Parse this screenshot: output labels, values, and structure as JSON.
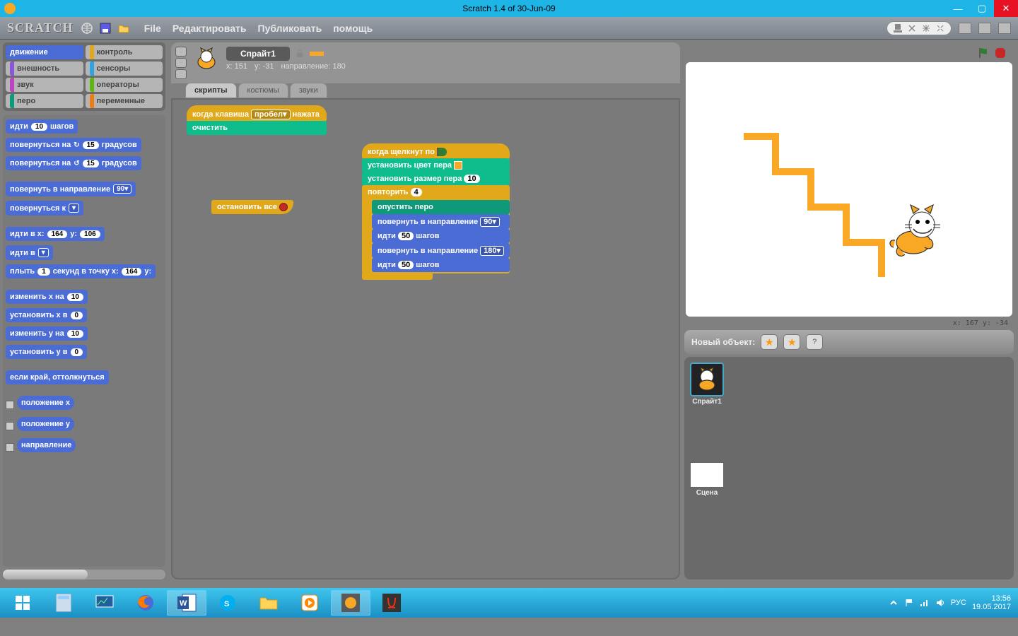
{
  "window": {
    "title": "Scratch 1.4 of 30-Jun-09"
  },
  "menu": {
    "logo": "SCRATCH",
    "items": {
      "file": "File",
      "edit": "Редактировать",
      "share": "Публиковать",
      "help": "помощь"
    }
  },
  "categories": {
    "motion": "движение",
    "control": "контроль",
    "looks": "внешность",
    "sensing": "сенсоры",
    "sound": "звук",
    "operators": "операторы",
    "pen": "перо",
    "variables": "переменные"
  },
  "palette": {
    "go_steps_pre": "идти",
    "go_steps_val": "10",
    "go_steps_post": "шагов",
    "turn_r_pre": "повернуться на",
    "turn_r_val": "15",
    "turn_r_post": "градусов",
    "turn_l_pre": "повернуться на",
    "turn_l_val": "15",
    "turn_l_post": "градусов",
    "point_dir_pre": "повернуть в направление",
    "point_dir_val": "90▾",
    "point_to_pre": "повернуться к",
    "point_to_val": "  ▾",
    "goto_xy_pre": "идти в x:",
    "goto_xy_x": "164",
    "goto_xy_mid": "y:",
    "goto_xy_y": "106",
    "goto_pre": "идти в",
    "goto_val": "  ▾",
    "glide_pre": "плыть",
    "glide_sec": "1",
    "glide_mid": "секунд в точку x:",
    "glide_x": "164",
    "glide_y_lbl": "y:",
    "change_x_pre": "изменить x на",
    "change_x_val": "10",
    "set_x_pre": "установить x в",
    "set_x_val": "0",
    "change_y_pre": "изменить y на",
    "change_y_val": "10",
    "set_y_pre": "установить y в",
    "set_y_val": "0",
    "bounce": "если край, оттолкнуться",
    "rep_x": "положение x",
    "rep_y": "положение y",
    "rep_dir": "направление"
  },
  "sprite": {
    "name": "Спрайт1",
    "info_x": "x: 151",
    "info_y": "y: -31",
    "info_dir": "направление: 180"
  },
  "tabs": {
    "scripts": "скрипты",
    "costumes": "костюмы",
    "sounds": "звуки"
  },
  "script1": {
    "when_key_pre": "когда клавиша",
    "when_key_val": "пробел▾",
    "when_key_post": "нажата",
    "clear": "очистить"
  },
  "script2": {
    "stop_all": "остановить все"
  },
  "script3": {
    "when_flag": "когда щелкнут по",
    "pen_color": "установить цвет пера",
    "pen_size_pre": "установить размер пера",
    "pen_size_val": "10",
    "repeat_pre": "повторить",
    "repeat_val": "4",
    "pen_down": "опустить перо",
    "point1_pre": "повернуть в направление",
    "point1_val": "90▾",
    "move1_pre": "идти",
    "move1_val": "50",
    "move1_post": "шагов",
    "point2_pre": "повернуть в направление",
    "point2_val": "180▾",
    "move2_pre": "идти",
    "move2_val": "50",
    "move2_post": "шагов"
  },
  "stage": {
    "coords": "x: 167   y: -34",
    "new_object": "Новый объект:",
    "sprite1": "Спрайт1",
    "scene": "Сцена"
  },
  "taskbar": {
    "lang": "РУС",
    "time": "13:56",
    "date": "19.05.2017"
  }
}
